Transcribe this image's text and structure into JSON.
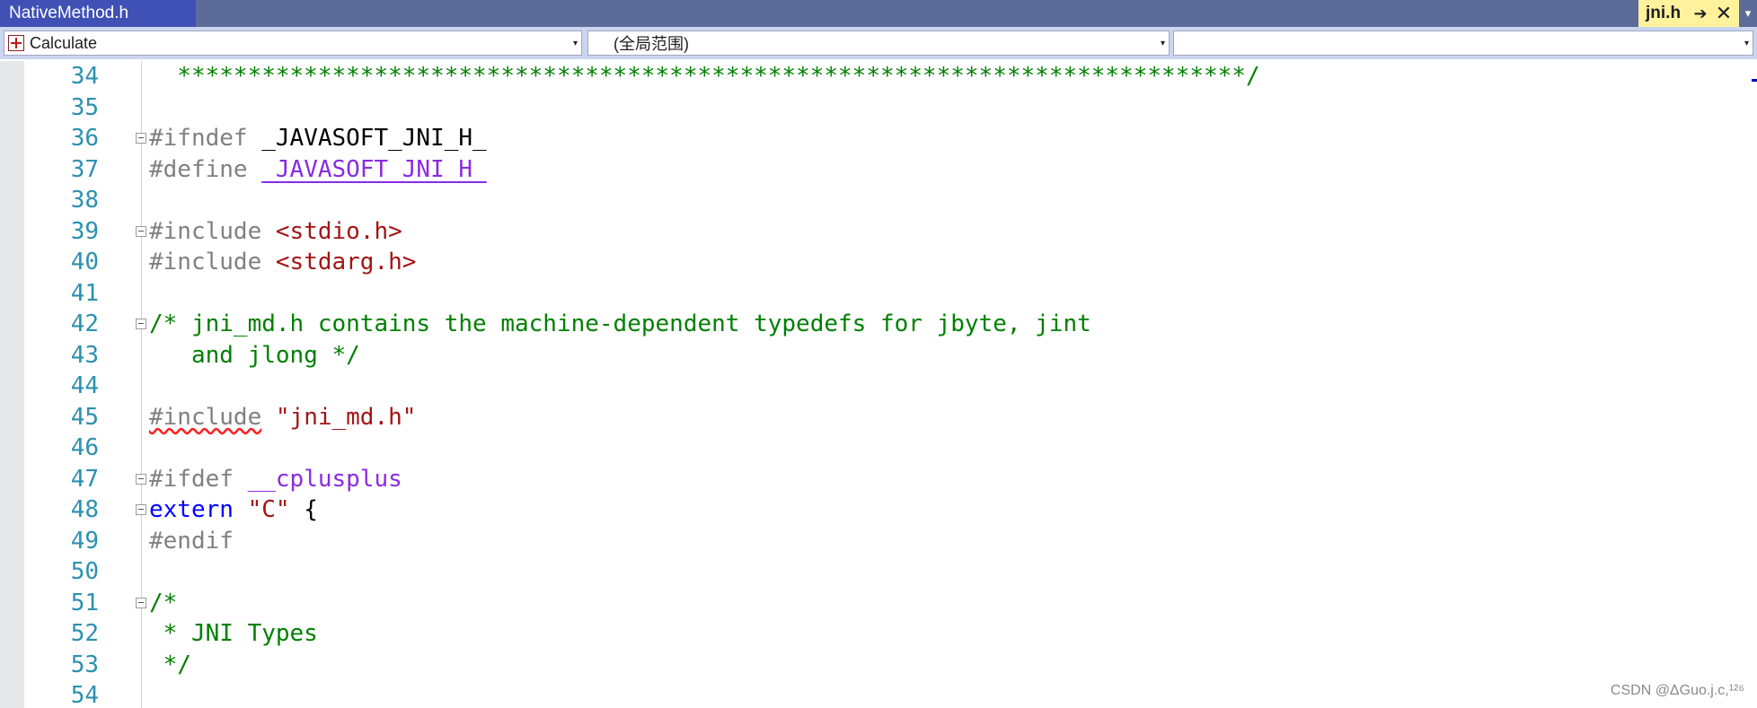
{
  "tabs": {
    "left_tab_title": "NativeMethod.h",
    "right_tab_title": "jni.h",
    "pin_glyph": "➔",
    "close_glyph": "✕",
    "menu_glyph": "▾"
  },
  "navbar": {
    "project_value": "Calculate",
    "scope_value": "(全局范围)",
    "member_value": "",
    "arrow_glyph": "▾"
  },
  "editor": {
    "lines": [
      {
        "num": "34",
        "fold": false,
        "spans": [
          {
            "c": "t-com",
            "t": "  ****************************************************************************/"
          }
        ]
      },
      {
        "num": "35",
        "fold": false,
        "spans": []
      },
      {
        "num": "36",
        "fold": true,
        "spans": [
          {
            "c": "t-pre",
            "t": "#ifndef "
          },
          {
            "c": "",
            "t": "_JAVASOFT_JNI_H_"
          }
        ]
      },
      {
        "num": "37",
        "fold": false,
        "spans": [
          {
            "c": "t-pre",
            "t": "#define "
          },
          {
            "c": "t-mac",
            "t": "_JAVASOFT_JNI_H_"
          }
        ]
      },
      {
        "num": "38",
        "fold": false,
        "spans": []
      },
      {
        "num": "39",
        "fold": true,
        "spans": [
          {
            "c": "t-pre",
            "t": "#include "
          },
          {
            "c": "t-str",
            "t": "<stdio.h>"
          }
        ]
      },
      {
        "num": "40",
        "fold": false,
        "spans": [
          {
            "c": "t-pre",
            "t": "#include "
          },
          {
            "c": "t-str",
            "t": "<stdarg.h>"
          }
        ]
      },
      {
        "num": "41",
        "fold": false,
        "spans": []
      },
      {
        "num": "42",
        "fold": true,
        "spans": [
          {
            "c": "t-com",
            "t": "/* jni_md.h contains the machine-dependent typedefs for jbyte, jint"
          }
        ]
      },
      {
        "num": "43",
        "fold": false,
        "spans": [
          {
            "c": "t-com",
            "t": "   and jlong */"
          }
        ]
      },
      {
        "num": "44",
        "fold": false,
        "spans": []
      },
      {
        "num": "45",
        "fold": false,
        "spans": [
          {
            "c": "t-pre t-err",
            "t": "#include"
          },
          {
            "c": "t-pre",
            "t": " "
          },
          {
            "c": "t-str",
            "t": "\"jni_md.h\""
          }
        ]
      },
      {
        "num": "46",
        "fold": false,
        "spans": []
      },
      {
        "num": "47",
        "fold": true,
        "spans": [
          {
            "c": "t-pre",
            "t": "#ifdef "
          },
          {
            "c": "t-mac-plain",
            "t": "__cplusplus"
          }
        ]
      },
      {
        "num": "48",
        "fold": true,
        "spans": [
          {
            "c": "t-kw",
            "t": "extern"
          },
          {
            "c": "",
            "t": " "
          },
          {
            "c": "t-str",
            "t": "\"C\""
          },
          {
            "c": "",
            "t": " {"
          }
        ]
      },
      {
        "num": "49",
        "fold": false,
        "spans": [
          {
            "c": "t-pre",
            "t": "#endif"
          }
        ]
      },
      {
        "num": "50",
        "fold": false,
        "spans": []
      },
      {
        "num": "51",
        "fold": true,
        "spans": [
          {
            "c": "t-com",
            "t": "/*"
          }
        ]
      },
      {
        "num": "52",
        "fold": false,
        "spans": [
          {
            "c": "t-com",
            "t": " * JNI Types"
          }
        ]
      },
      {
        "num": "53",
        "fold": false,
        "spans": [
          {
            "c": "t-com",
            "t": " */"
          }
        ]
      },
      {
        "num": "54",
        "fold": false,
        "spans": []
      }
    ]
  },
  "watermark": "CSDN @ΔGuo.j.c,¹²⁶"
}
